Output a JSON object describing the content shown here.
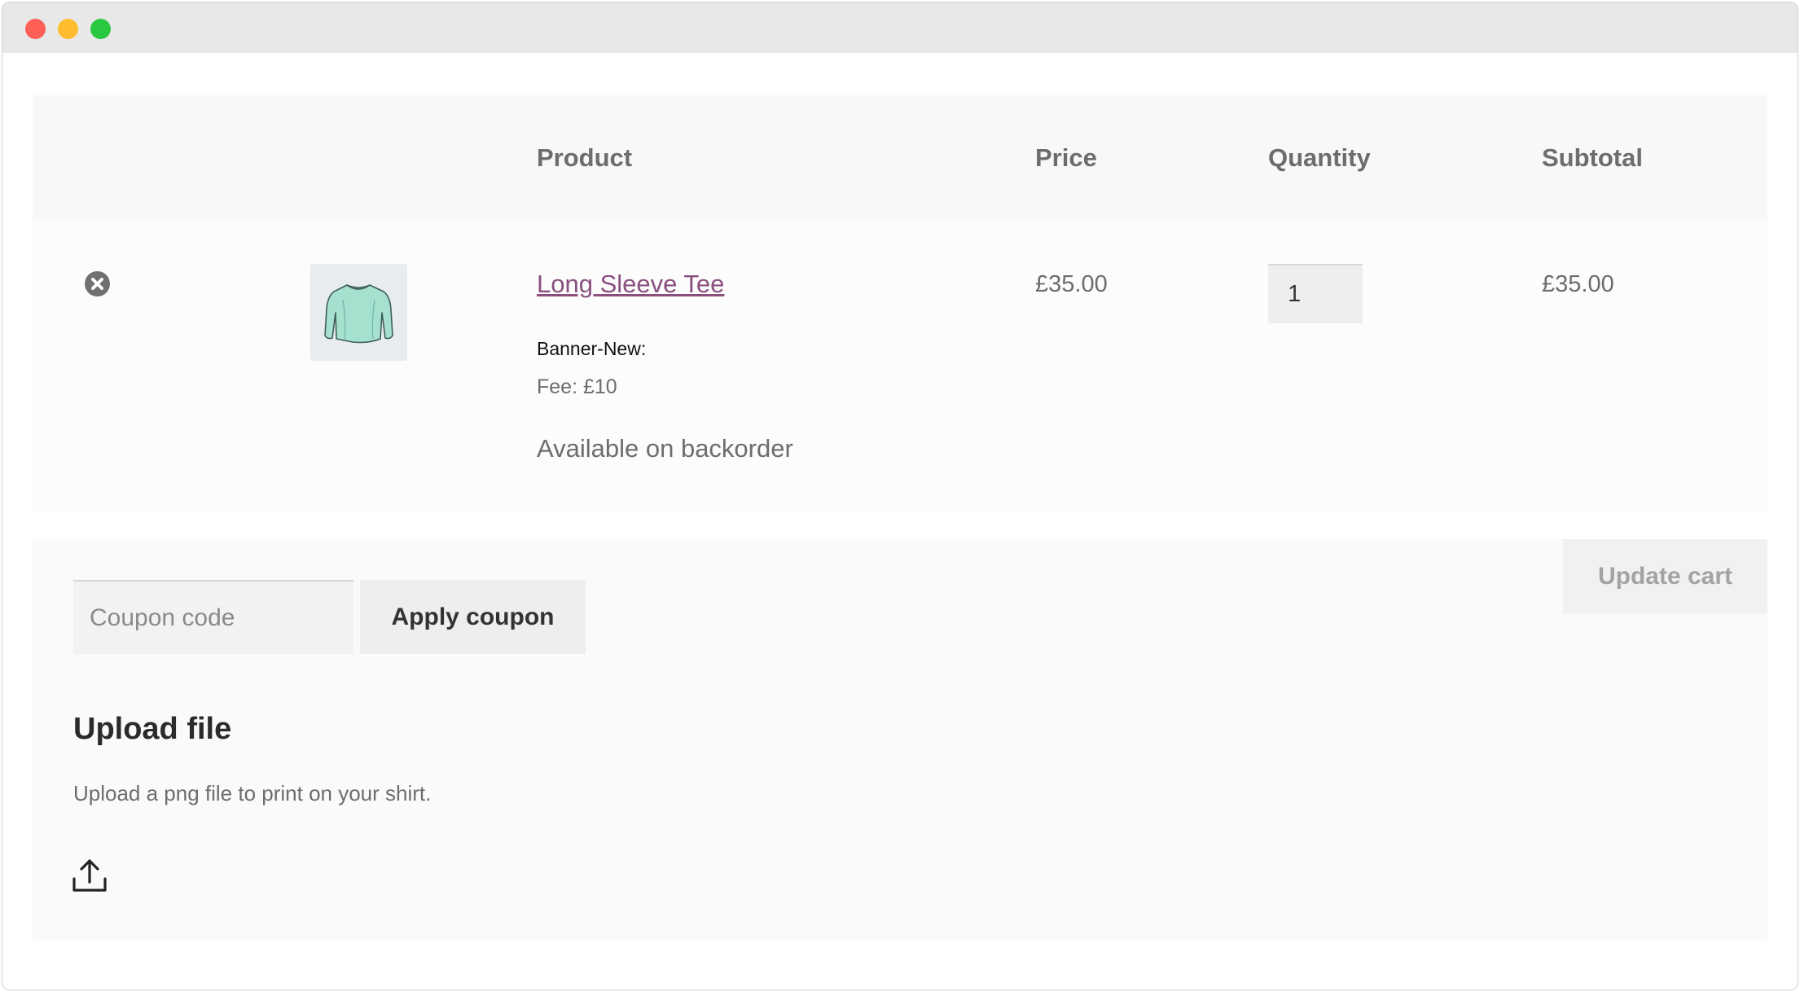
{
  "cart": {
    "columns": {
      "product": "Product",
      "price": "Price",
      "quantity": "Quantity",
      "subtotal": "Subtotal"
    },
    "items": [
      {
        "name": "Long Sleeve Tee",
        "meta_key": "Banner-New:",
        "meta_fee": "Fee: £10",
        "stock_status": "Available on backorder",
        "price": "£35.00",
        "quantity": "1",
        "subtotal": "£35.00",
        "thumbnail_icon": "shirt-icon",
        "remove_icon": "remove-circle-icon"
      }
    ]
  },
  "actions": {
    "coupon_placeholder": "Coupon code",
    "apply_coupon_label": "Apply coupon",
    "update_cart_label": "Update cart"
  },
  "upload": {
    "title": "Upload file",
    "description": "Upload a png file to print on your shirt.",
    "icon": "upload-icon"
  },
  "colors": {
    "link": "#8a4f7f",
    "header_bg": "#f8f8f8",
    "text_muted": "#6d6d6d"
  }
}
